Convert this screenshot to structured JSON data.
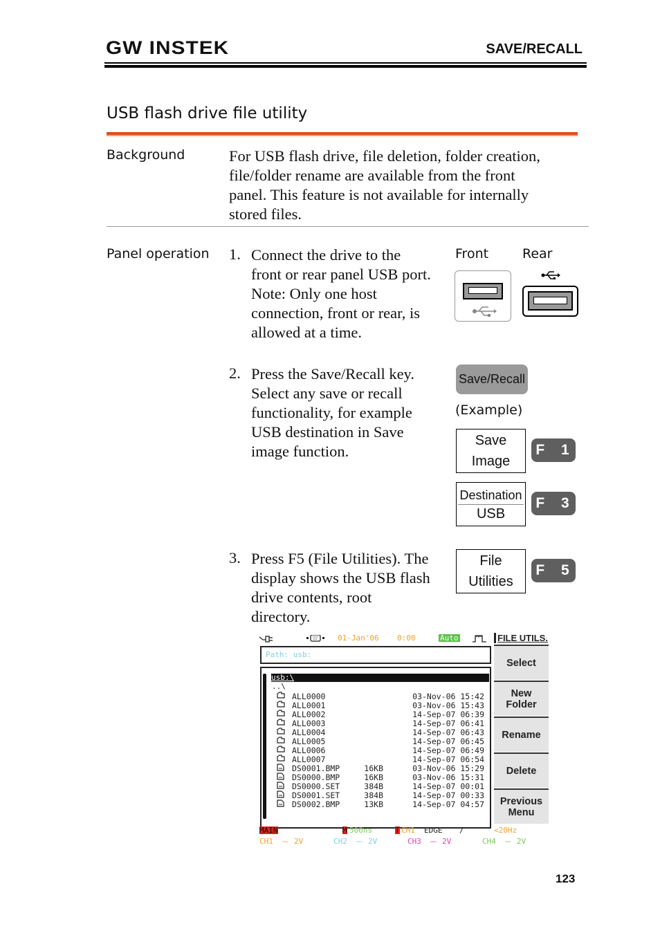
{
  "header": {
    "brand": "GW INSTEK",
    "section": "SAVE/RECALL"
  },
  "title": "USB flash drive file utility",
  "background": {
    "label": "Background",
    "lines": [
      "For USB flash drive, file deletion, folder creation,",
      "file/folder rename are available from the front",
      "panel. This feature is not available for internally",
      "stored files."
    ]
  },
  "panel_operation": {
    "label": "Panel operation",
    "steps": [
      {
        "num": "1.",
        "lines": [
          "Connect the drive to the",
          "front or rear panel USB port.",
          "Note: Only one host",
          "connection, front or rear, is",
          "allowed at a time."
        ]
      },
      {
        "num": "2.",
        "lines": [
          "Press the Save/Recall key.",
          "Select any save or recall",
          "functionality, for example",
          "USB destination in Save",
          "image function."
        ]
      },
      {
        "num": "3.",
        "lines": [
          "Press F5 (File Utilities). The",
          "display shows the USB flash",
          "drive contents, root",
          "directory."
        ]
      }
    ],
    "usb_front_label": "Front",
    "usb_rear_label": "Rear",
    "save_recall_key": "Save/Recall",
    "example_label": "(Example)",
    "menu_save_image": [
      "Save",
      "Image"
    ],
    "menu_destination": {
      "title": "Destination",
      "value": "USB"
    },
    "menu_file_utilities": [
      "File",
      "Utilities"
    ],
    "fkeys": {
      "f1": "F 1",
      "f3": "F 3",
      "f5": "F 5"
    }
  },
  "scope": {
    "date": "01-Jan'06",
    "time": "0:00",
    "trigger_mode": "Auto",
    "menu_title": "FILE UTILS.",
    "path": "Path: usb:",
    "current_dir": "usb:\\",
    "parent": "..\\",
    "entries": [
      {
        "type": "folder",
        "name": "ALL0000",
        "size": "",
        "date": "03-Nov-06",
        "time": "15:42"
      },
      {
        "type": "folder",
        "name": "ALL0001",
        "size": "",
        "date": "03-Nov-06",
        "time": "15:43"
      },
      {
        "type": "folder",
        "name": "ALL0002",
        "size": "",
        "date": "14-Sep-07",
        "time": "06:39"
      },
      {
        "type": "folder",
        "name": "ALL0003",
        "size": "",
        "date": "14-Sep-07",
        "time": "06:41"
      },
      {
        "type": "folder",
        "name": "ALL0004",
        "size": "",
        "date": "14-Sep-07",
        "time": "06:43"
      },
      {
        "type": "folder",
        "name": "ALL0005",
        "size": "",
        "date": "14-Sep-07",
        "time": "06:45"
      },
      {
        "type": "folder",
        "name": "ALL0006",
        "size": "",
        "date": "14-Sep-07",
        "time": "06:49"
      },
      {
        "type": "folder",
        "name": "ALL0007",
        "size": "",
        "date": "14-Sep-07",
        "time": "06:54"
      },
      {
        "type": "file",
        "name": "DS0001.BMP",
        "size": "16KB",
        "date": "03-Nov-06",
        "time": "15:29"
      },
      {
        "type": "file",
        "name": "DS0000.BMP",
        "size": "16KB",
        "date": "03-Nov-06",
        "time": "15:31"
      },
      {
        "type": "file",
        "name": "DS0000.SET",
        "size": "384B",
        "date": "14-Sep-07",
        "time": "00:01"
      },
      {
        "type": "file",
        "name": "DS0001.SET",
        "size": "384B",
        "date": "14-Sep-07",
        "time": "00:33"
      },
      {
        "type": "file",
        "name": "DS0002.BMP",
        "size": "13KB",
        "date": "14-Sep-07",
        "time": "04:57"
      }
    ],
    "softkeys": [
      "Select",
      "New\nFolder",
      "Rename",
      "Delete",
      "Previous\nMenu"
    ],
    "status": {
      "main": "MAIN",
      "timebase_marker": "M",
      "timebase": "500ns",
      "trigger_marker": "T",
      "trigger_source": "CH1",
      "trigger_type": "EDGE",
      "trigger_slope": "/",
      "frequency": "<20Hz"
    },
    "channels": [
      {
        "name": "CH1",
        "scale": "2V",
        "color": "#f2a12a"
      },
      {
        "name": "CH2",
        "scale": "2V",
        "color": "#7fd0de"
      },
      {
        "name": "CH3",
        "scale": "2V",
        "color": "#e040b0"
      },
      {
        "name": "CH4",
        "scale": "2V",
        "color": "#7cc95a"
      }
    ],
    "colors": {
      "date": "#f2a12a",
      "path": "#7fd0de",
      "auto_bg": "#5cc24a",
      "main_bg": "#e0201a",
      "timebase": "#7cc95a"
    }
  },
  "page_number": "123"
}
